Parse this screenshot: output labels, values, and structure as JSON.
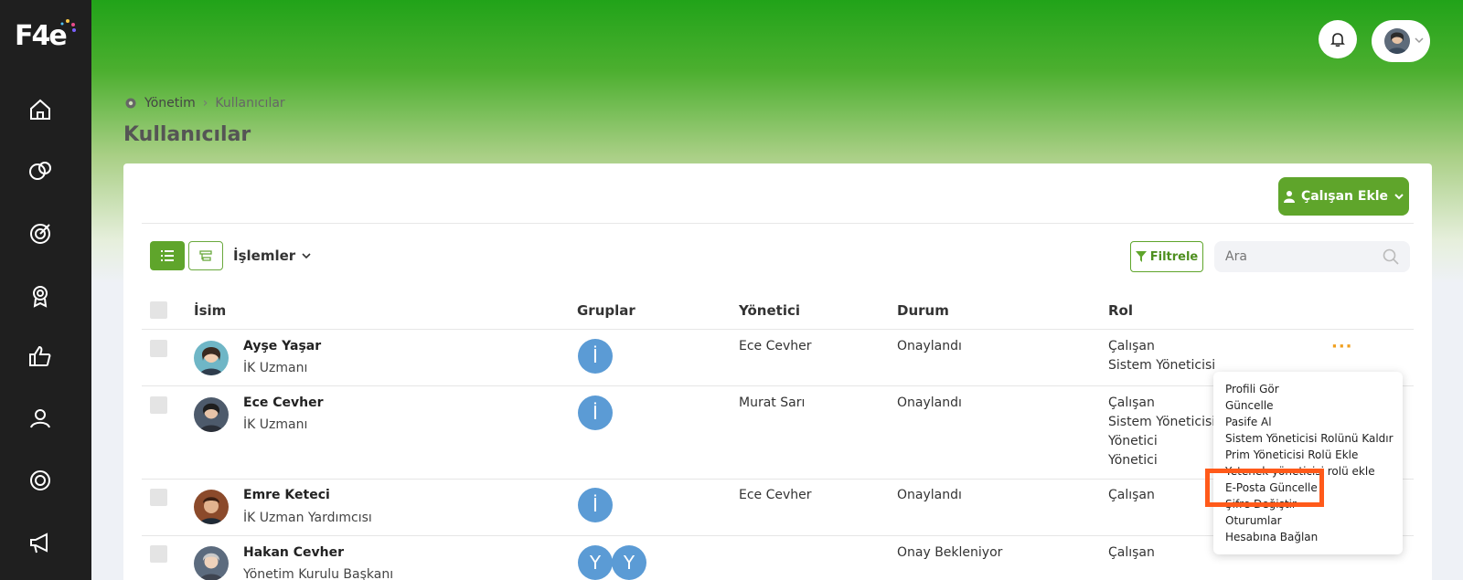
{
  "logo": {
    "text": "F4e"
  },
  "breadcrumb": {
    "root": "Yönetim",
    "current": "Kullanıcılar"
  },
  "page": {
    "title": "Kullanıcılar"
  },
  "toolbar": {
    "add_employee_label": "Çalışan Ekle",
    "actions_label": "İşlemler",
    "filter_label": "Filtrele",
    "search_placeholder": "Ara"
  },
  "table": {
    "columns": [
      "İsim",
      "Gruplar",
      "Yönetici",
      "Durum",
      "Rol"
    ],
    "rows": [
      {
        "name": "Ayşe Yaşar",
        "title": "İK Uzmanı",
        "groups": [
          "İ"
        ],
        "manager": "Ece Cevher",
        "status": "Onaylandı",
        "roles": [
          "Çalışan",
          "Sistem Yöneticisi"
        ]
      },
      {
        "name": "Ece Cevher",
        "title": "İK Uzmanı",
        "groups": [
          "İ"
        ],
        "manager": "Murat Sarı",
        "status": "Onaylandı",
        "roles": [
          "Çalışan",
          "Sistem Yöneticisi",
          "Yönetici",
          "Yönetici"
        ]
      },
      {
        "name": "Emre Keteci",
        "title": "İK Uzman Yardımcısı",
        "groups": [
          "İ"
        ],
        "manager": "Ece Cevher",
        "status": "Onaylandı",
        "roles": [
          "Çalışan"
        ]
      },
      {
        "name": "Hakan Cevher",
        "title": "Yönetim Kurulu Başkanı",
        "groups": [
          "Y",
          "Y"
        ],
        "manager": "",
        "status": "Onay Bekleniyor",
        "roles": [
          "Çalışan"
        ]
      }
    ]
  },
  "context_menu": {
    "items": [
      "Profili Gör",
      "Güncelle",
      "Pasife Al",
      "Sistem Yöneticisi Rolünü Kaldır",
      "Prim Yöneticisi Rolü Ekle",
      "Yetenek yöneticisi rolü ekle",
      "E-Posta Güncelle",
      "Şifre Değiştir",
      "Oturumlar",
      "Hesabına Bağlan"
    ]
  },
  "colors": {
    "brand_green": "#5fa52b",
    "sidebar": "#1f1f1f",
    "group_badge": "#5b9bd5",
    "highlight": "#ff5a1a",
    "more_dots": "#f0a020"
  },
  "icons": [
    "home-icon",
    "chat-icon",
    "target-icon",
    "award-icon",
    "thumbs-up-icon",
    "users-icon",
    "gear-icon",
    "megaphone-icon",
    "bell-icon",
    "filter-icon",
    "search-icon"
  ]
}
